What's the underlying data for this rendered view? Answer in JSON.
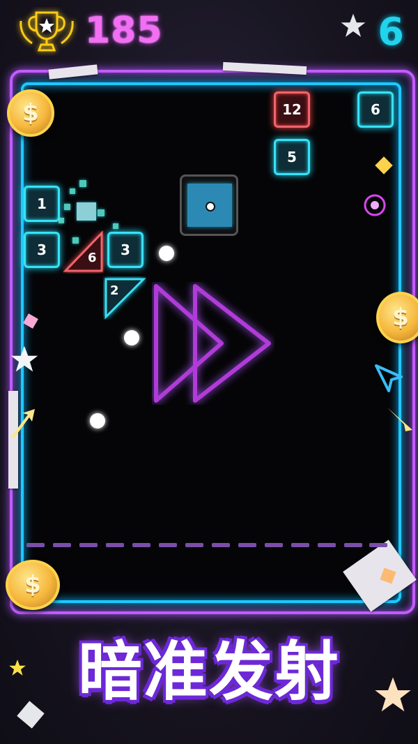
{
  "hud": {
    "trophy_icon": "trophy-icon",
    "score": "185",
    "balls_count": "6"
  },
  "blocks": [
    {
      "id": "b12",
      "value": "12",
      "color": "red"
    },
    {
      "id": "b6a",
      "value": "6",
      "color": "cyan"
    },
    {
      "id": "b5",
      "value": "5",
      "color": "cyan"
    },
    {
      "id": "b1",
      "value": "1",
      "color": "cyan"
    },
    {
      "id": "b3a",
      "value": "3",
      "color": "cyan"
    },
    {
      "id": "b3b",
      "value": "3",
      "color": "cyan"
    }
  ],
  "triangles": [
    {
      "id": "t6",
      "value": "6",
      "color": "red"
    },
    {
      "id": "t2",
      "value": "2",
      "color": "cyan"
    }
  ],
  "powerup_icon": "ball-bonus-icon",
  "fast_forward_icon": "fast-forward-icon",
  "coin_symbol": "$",
  "caption": "暗准发射",
  "colors": {
    "score": "#f26ff3",
    "balls": "#22d3ee",
    "frame_outer": "#c45cff",
    "frame_inner": "#1ec8ff",
    "block_red": "#f0646e",
    "block_cyan": "#38e1f5"
  }
}
